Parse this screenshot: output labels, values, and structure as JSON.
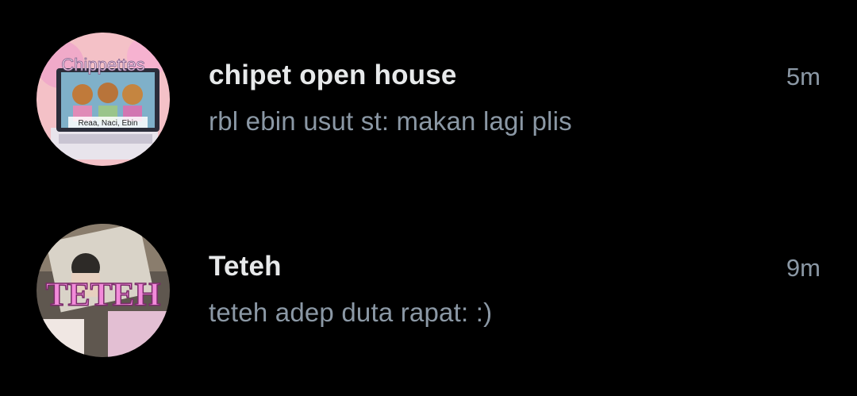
{
  "conversations": [
    {
      "name": "chipet open house",
      "time": "5m",
      "preview": "rbl ebin usut st: makan lagi plis",
      "avatar": {
        "logo_text": "Chippettes",
        "caption": "Reaa, Naci, Ebin",
        "colors": {
          "bg": "#f6c3c8",
          "accent": "#e7a2c7",
          "laptop": "#e9e7ee"
        }
      }
    },
    {
      "name": "Teteh",
      "time": "9m",
      "preview": "teteh adep duta rapat: :)",
      "avatar": {
        "logo_text": "TETEH",
        "colors": {
          "bg": "#6b6157",
          "text": "#f08ad8",
          "shirt": "#e6bfd2"
        }
      }
    }
  ]
}
